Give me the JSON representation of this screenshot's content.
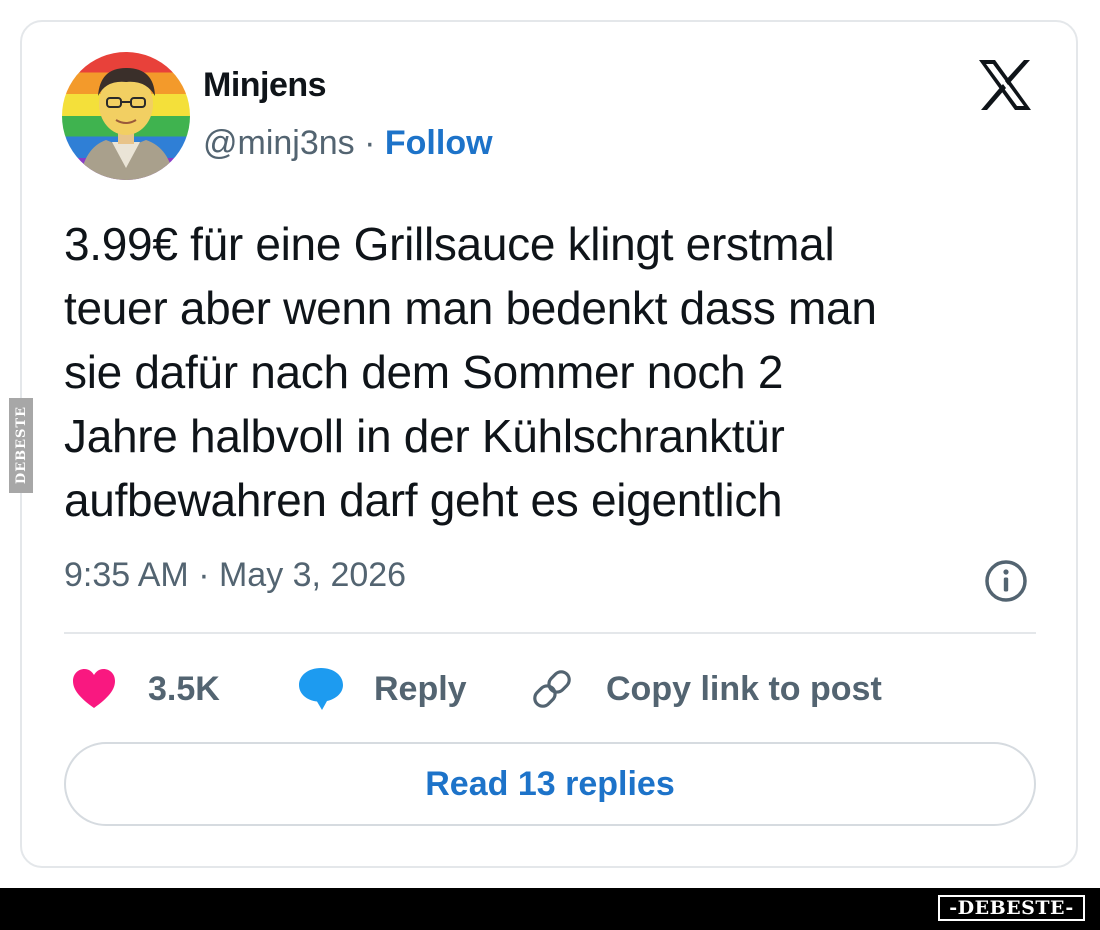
{
  "tweet": {
    "author": {
      "name": "Minjens",
      "handle": "@minj3ns",
      "separator": " · ",
      "follow_label": "Follow"
    },
    "text_lines": [
      "3.99€ für eine Grillsauce klingt erstmal",
      "teuer aber wenn man bedenkt dass man",
      "sie dafür nach dem Sommer noch 2",
      "Jahre halbvoll in der Kühlschranktür",
      "aufbewahren darf geht es eigentlich"
    ],
    "timestamp": "9:35 AM · May 3, 2026",
    "actions": {
      "likes": "3.5K",
      "reply": "Reply",
      "copy_link": "Copy link to post"
    },
    "read_replies": "Read 13 replies"
  },
  "icons": {
    "platform": "x-logo-icon",
    "info": "info-icon",
    "like": "heart-icon",
    "reply": "speech-bubble-icon",
    "link": "link-icon"
  },
  "colors": {
    "link_blue": "#1d73c9",
    "heart": "#f91880",
    "reply_bubble": "#1d9bf0",
    "muted_text": "#536471",
    "primary_text": "#0f1419"
  },
  "watermark": {
    "side": "DEBESTE",
    "footer": "-DEBESTE-"
  }
}
